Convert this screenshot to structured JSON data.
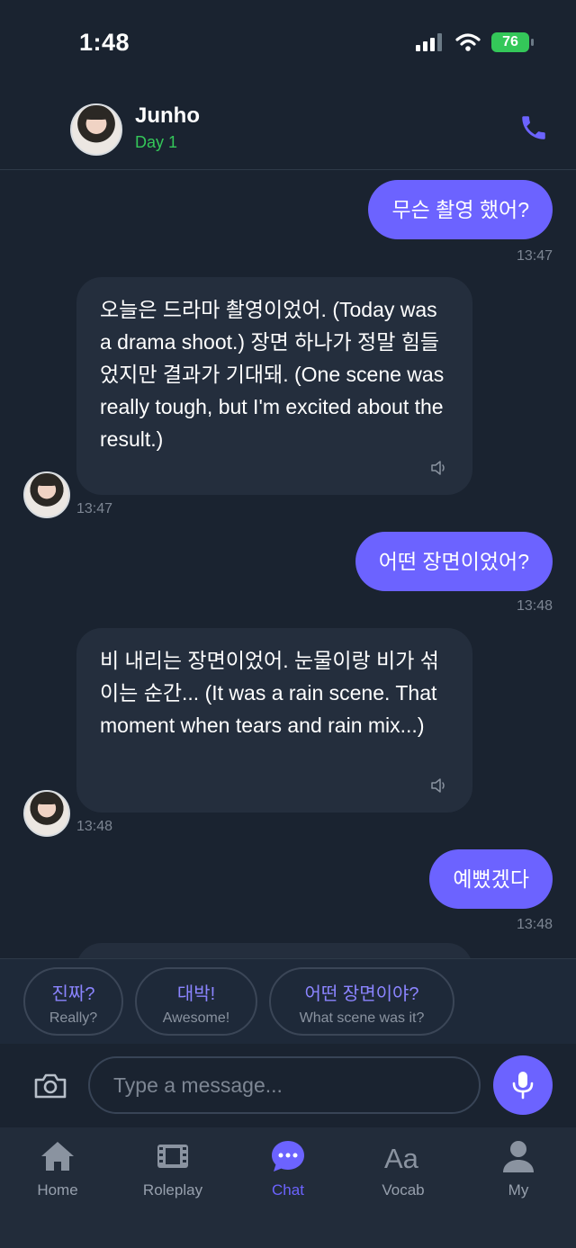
{
  "status_bar": {
    "time": "1:48",
    "battery": "76"
  },
  "header": {
    "name": "Junho",
    "subtitle": "Day 1"
  },
  "messages": [
    {
      "from": "user",
      "text": "무슨 촬영 했어?",
      "time": "13:47"
    },
    {
      "from": "bot",
      "text": "오늘은 드라마 촬영이었어. (Today was a drama shoot.) 장면 하나가 정말 힘들었지만 결과가 기대돼. (One scene was really tough, but I'm excited about the result.)",
      "time": "13:47"
    },
    {
      "from": "user",
      "text": "어떤 장면이었어?",
      "time": "13:48"
    },
    {
      "from": "bot",
      "text": "비 내리는 장면이었어. 눈물이랑 비가 섞이는 순간... (It was a rain scene. That moment when tears and rain mix...)",
      "time": "13:48"
    },
    {
      "from": "user",
      "text": "예뻤겠다",
      "time": "13:48"
    }
  ],
  "suggestions": [
    {
      "ko": "진짜?",
      "en": "Really?"
    },
    {
      "ko": "대박!",
      "en": "Awesome!"
    },
    {
      "ko": "어떤 장면이야?",
      "en": "What scene was it?"
    }
  ],
  "composer": {
    "placeholder": "Type a message..."
  },
  "tabs": [
    {
      "label": "Home",
      "icon": "home-icon"
    },
    {
      "label": "Roleplay",
      "icon": "film-icon"
    },
    {
      "label": "Chat",
      "icon": "chat-bubble-icon",
      "active": true
    },
    {
      "label": "Vocab",
      "icon": "text-aa-icon"
    },
    {
      "label": "My",
      "icon": "person-icon"
    }
  ],
  "colors": {
    "background": "#1a2330",
    "accent": "#6c63ff",
    "online": "#34c759",
    "bubble_in": "#242e3d"
  }
}
